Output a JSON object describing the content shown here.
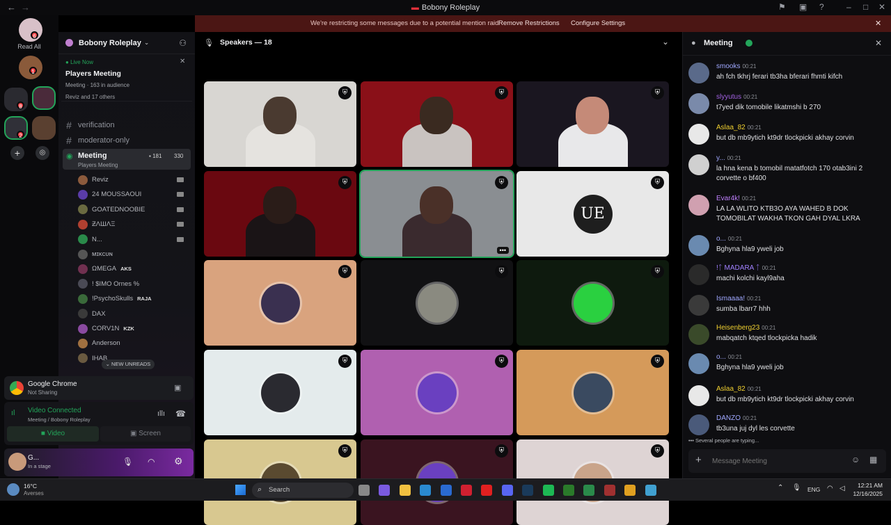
{
  "titlebar": {
    "title": "Bobony Roleplay",
    "back": "←",
    "forward": "→"
  },
  "rail": {
    "read_all": "Read All",
    "badges": [
      "6",
      "1",
      "8",
      "2"
    ]
  },
  "banner": {
    "message": "We're restricting some messages due to a potential mention raid",
    "remove": "Remove Restrictions",
    "configure": "Configure Settings",
    "close": "✕"
  },
  "server": {
    "name": "Bobony Roleplay"
  },
  "live": {
    "status": "Live Now",
    "title": "Players Meeting",
    "channel": "Meeting",
    "audience": "163 in audience",
    "attendees": "Reviz and 17 others"
  },
  "channels": [
    {
      "name": "verification"
    },
    {
      "name": "moderator-only"
    }
  ],
  "active_channel": {
    "name": "Meeting",
    "subtitle": "Players Meeting",
    "count1": "181",
    "count2": "330"
  },
  "members": [
    {
      "name": "Reviz",
      "color": "#8b5a3c",
      "tag": ""
    },
    {
      "name": "24 MOUSSAOUI",
      "color": "#5a3ca8",
      "tag": ""
    },
    {
      "name": "GOATEDNOOBIE",
      "color": "#6a6a40",
      "tag": ""
    },
    {
      "name": "ƵΛШΛΞ",
      "color": "#b04030",
      "tag": ""
    },
    {
      "name": "N...",
      "color": "#2a8a4a",
      "tag": ""
    },
    {
      "name": "ᴍɪᴋᴄᴜɴ",
      "color": "#555",
      "tag": ""
    },
    {
      "name": "ΩMEGA",
      "color": "#703050",
      "tag": "AKS"
    },
    {
      "name": "! $IMO Ornes %",
      "color": "#4a4a55",
      "tag": ""
    },
    {
      "name": "!PsychoSkulls",
      "color": "#3a6a3a",
      "tag": "RAJA"
    },
    {
      "name": "DAX",
      "color": "#3a3a3a",
      "tag": ""
    },
    {
      "name": "CORV1N",
      "color": "#8a4aa0",
      "tag": "KZK"
    },
    {
      "name": "Anderson",
      "color": "#a07040",
      "tag": ""
    },
    {
      "name": "IHAB",
      "color": "#6a5a40",
      "tag": ""
    }
  ],
  "new_unreads": "NEW UNREADS",
  "activity": {
    "app": "Google Chrome",
    "status": "Not Sharing"
  },
  "voice": {
    "status": "Video Connected",
    "location": "Meeting",
    "server": "/ Bobony Roleplay",
    "video": "Video",
    "screen": "Screen"
  },
  "user": {
    "name": "G...",
    "status": "In a stage"
  },
  "stage": {
    "speakers_label": "Speakers — 18"
  },
  "tiles": [
    {
      "bg": "#d8d6d2",
      "kind": "cam",
      "person": "#4a3a30",
      "shirt": "#e5e3df"
    },
    {
      "bg": "#8a1018",
      "kind": "cam",
      "person": "#3a2a20",
      "shirt": "#c9c3c0"
    },
    {
      "bg": "#1a1620",
      "kind": "cam",
      "person": "#c58a78",
      "shirt": "#e8e8ea"
    },
    {
      "bg": "#6a0810",
      "kind": "cam",
      "person": "#2a1c18",
      "shirt": "#1a1416"
    },
    {
      "bg": "#8a8e92",
      "kind": "cam",
      "person": "#4a3028",
      "shirt": "#3a2a2e",
      "selected": true
    },
    {
      "bg": "#e8e8e8",
      "kind": "logo",
      "avatar": "#1e1e1e",
      "label": "UE"
    },
    {
      "bg": "#d9a37e",
      "kind": "avatar",
      "avatar": "#3a3050"
    },
    {
      "bg": "#111113",
      "kind": "avatar",
      "avatar": "#8a8a80"
    },
    {
      "bg": "#0e1a0e",
      "kind": "avatar",
      "avatar": "#2ad040"
    },
    {
      "bg": "#e4ebec",
      "kind": "avatar",
      "avatar": "#2a2a30"
    },
    {
      "bg": "#b060b0",
      "kind": "avatar",
      "avatar": "#6a40c0"
    },
    {
      "bg": "#d59a5a",
      "kind": "avatar",
      "avatar": "#3a4a60"
    },
    {
      "bg": "#d8c890",
      "kind": "avatar",
      "avatar": "#5a4a30"
    },
    {
      "bg": "#3a1420",
      "kind": "avatar",
      "avatar": "#6a40c0"
    },
    {
      "bg": "#ded4d4",
      "kind": "avatar",
      "avatar": "#c9a48a"
    }
  ],
  "chat": {
    "title": "Meeting",
    "placeholder": "Message Meeting",
    "typing": "Several people are typing...",
    "messages": [
      {
        "name": "smooks",
        "color": "#a0a8ff",
        "time": "00:21",
        "text": "ah fch tkhrj ferari tb3ha bferari fhmti kifch",
        "av": "#5a6a8a"
      },
      {
        "name": "slyyutus",
        "color": "#a060e0",
        "time": "00:21",
        "text": "t7yed dik tomobile likatmshi b 270",
        "av": "#7a8aaa"
      },
      {
        "name": "Aslaa_82",
        "color": "#f0d030",
        "time": "00:21",
        "text": "but db mb9ytich kt9dr tlockpicki akhay corvin",
        "av": "#e8e8e8"
      },
      {
        "name": "y...",
        "color": "#a0a8ff",
        "time": "00:21",
        "text": "la hna kena b tomobil matatfotch 170 otab3ini 2 corvette o bf400",
        "av": "#d0d0d0"
      },
      {
        "name": "Evar4k!",
        "color": "#c080ff",
        "time": "00:21",
        "text": "LA LA WLITO KTB3O AYA WAHED B DOK TOMOBILAT WAKHA TKON GAH DYAL LKRA",
        "av": "#d0a0b0"
      },
      {
        "name": "o...",
        "color": "#a0a8ff",
        "time": "00:21",
        "text": "Bghyna hla9 yweli job",
        "av": "#6a8ab0"
      },
      {
        "name": "!ᛏ MADARA ᛏ",
        "color": "#a080ff",
        "time": "00:21",
        "text": "machi kolchi kayl9aha",
        "av": "#2a2a2a"
      },
      {
        "name": "Ismaaaa!",
        "color": "#a0a8ff",
        "time": "00:21",
        "text": "sumba lbarr7 hhh",
        "av": "#3a3a3a"
      },
      {
        "name": "Heisenberg23",
        "color": "#f0d030",
        "time": "00:21",
        "text": "mabqatch ktqed tlockpicka hadik",
        "av": "#3a4a2a"
      },
      {
        "name": "o...",
        "color": "#a0a8ff",
        "time": "00:21",
        "text": "Bghyna hla9 yweli job",
        "av": "#6a8ab0"
      },
      {
        "name": "Aslaa_82",
        "color": "#f0d030",
        "time": "00:21",
        "text": "but db mb9ytich kt9dr tlockpicki akhay corvin",
        "av": "#e8e8e8"
      },
      {
        "name": "DANZO",
        "color": "#a0a8ff",
        "time": "00:21",
        "text": "tb3una juj dyl les corvette",
        "av": "#4a5a7a"
      }
    ]
  },
  "taskbar": {
    "temp": "16°C",
    "weather": "Averses",
    "search": "Search",
    "lang": "ENG",
    "time": "12:21 AM",
    "date": "12/16/2025"
  }
}
